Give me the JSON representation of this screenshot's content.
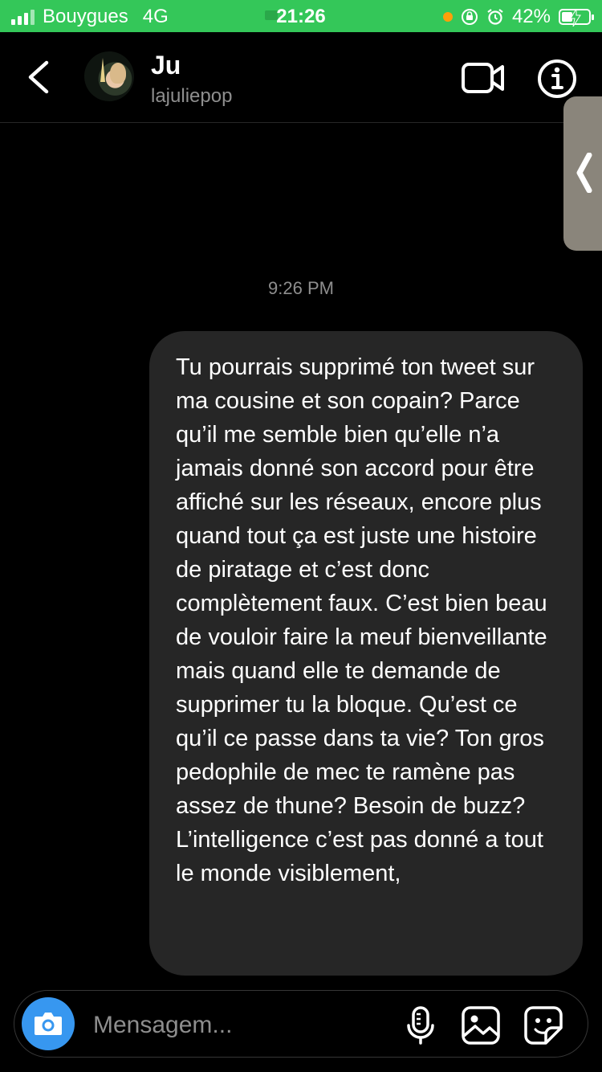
{
  "status_bar": {
    "carrier": "Bouygues",
    "network": "4G",
    "time": "21:26",
    "battery": "42%",
    "battery_level": 0.42,
    "background_color": "#34c759"
  },
  "header": {
    "name": "Ju",
    "username": "lajuliepop",
    "icons": [
      "chevron-left-icon",
      "avatar",
      "video-camera-icon",
      "info-icon"
    ]
  },
  "thread": {
    "timestamp": "9:26 PM",
    "messages": [
      {
        "direction": "outgoing",
        "text": "Tu pourrais supprimé ton tweet sur ma cousine et son copain? Parce qu’il me semble bien qu’elle n’a jamais donné son accord pour être affiché sur les réseaux, encore plus quand tout ça est juste une histoire de piratage et c’est donc complètement faux. C’est bien beau de vouloir faire la meuf bienveillante mais quand elle te demande de supprimer tu la bloque. Qu’est ce qu’il ce passe dans ta vie? Ton gros pedophile de mec te ramène pas assez de thune? Besoin de buzz? L’intelligence c’est pas donné a tout le monde visiblement,"
      }
    ]
  },
  "composer": {
    "placeholder": "Mensagem...",
    "value": "",
    "icons": [
      "camera-icon",
      "microphone-icon",
      "gallery-icon",
      "sticker-icon"
    ],
    "camera_color": "#3797f0"
  }
}
